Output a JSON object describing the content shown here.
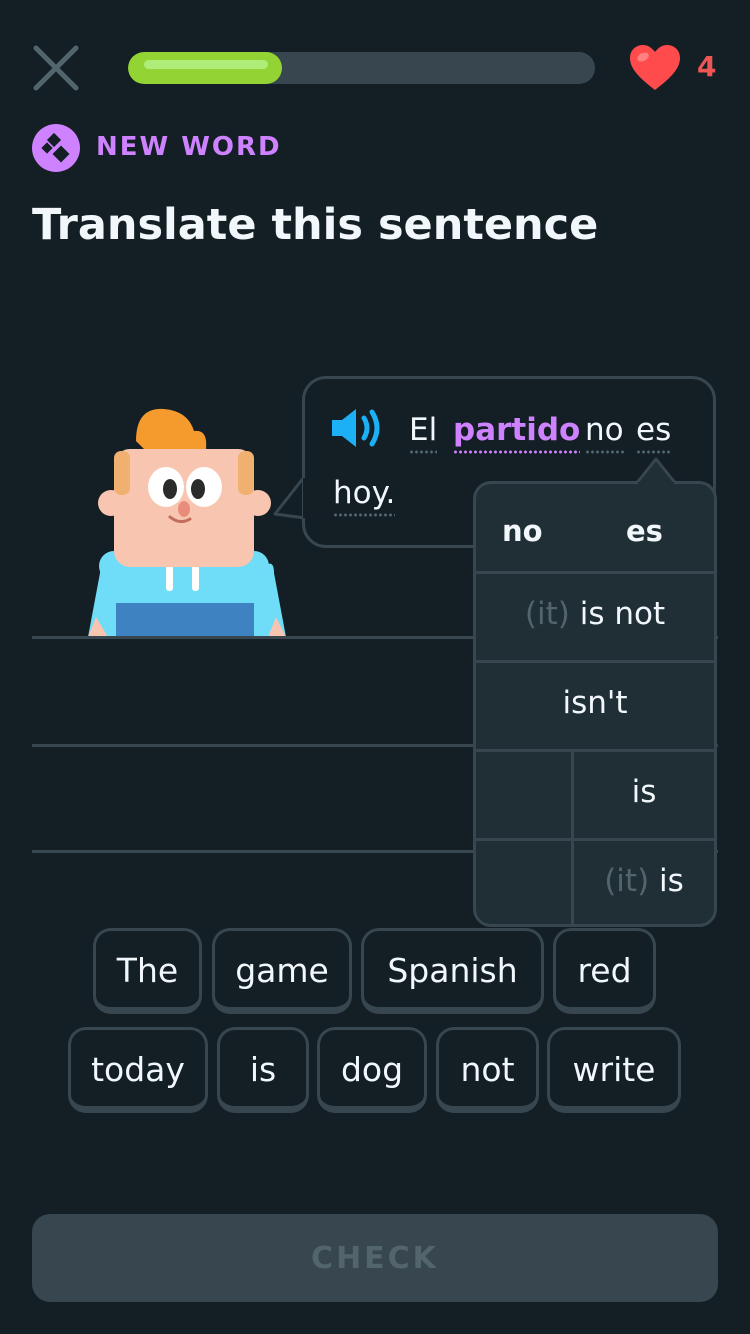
{
  "top_bar": {
    "close_icon": "close-icon",
    "progress_fraction": 0.33,
    "hearts": "4",
    "heart_icon": "heart-icon"
  },
  "header": {
    "badge_label": "NEW WORD",
    "badge_icon": "new-word-icon",
    "instruction": "Translate this sentence"
  },
  "prompt": {
    "speaker_icon": "speaker-icon",
    "tokens": [
      "El",
      "partido",
      "no",
      "es",
      "hoy."
    ],
    "new_word": "partido"
  },
  "tooltip": {
    "headers": [
      "no",
      "es"
    ],
    "rows": [
      {
        "muted": "(it)",
        "text": "is not"
      },
      {
        "muted": "",
        "text": "isn't"
      },
      {
        "muted": "",
        "text": "is"
      },
      {
        "muted": "(it)",
        "text": "is"
      }
    ]
  },
  "word_bank": {
    "row1": [
      "The",
      "game",
      "Spanish",
      "red"
    ],
    "row2": [
      "today",
      "is",
      "dog",
      "not",
      "write"
    ]
  },
  "check_label": "CHECK",
  "colors": {
    "background": "#131f24",
    "border": "#37464f",
    "progress": "#93d333",
    "accent_purple": "#ce82ff",
    "heart": "#ff4b4b",
    "speaker": "#1cb0f6"
  }
}
